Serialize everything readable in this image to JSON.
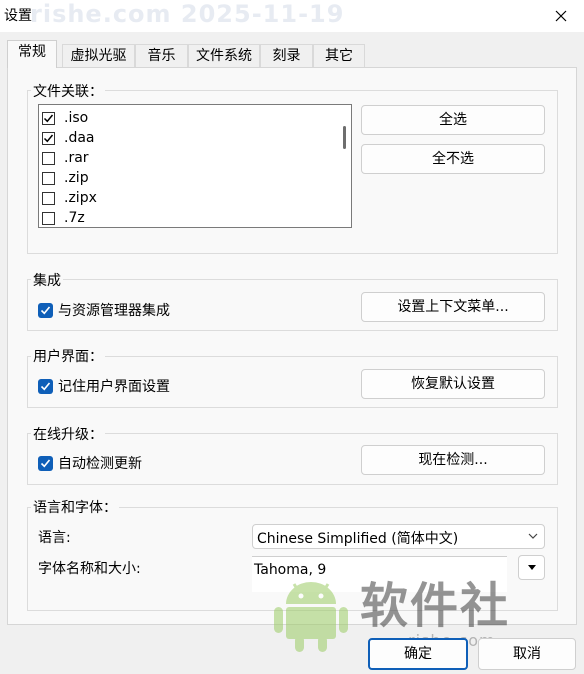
{
  "window": {
    "title": "设置",
    "watermark": "rishe.com 2025-11-19"
  },
  "tabs": [
    "常规",
    "虚拟光驱",
    "音乐",
    "文件系统",
    "刻录",
    "其它"
  ],
  "active_tab": "常规",
  "file_assoc": {
    "title": "文件关联：",
    "items": [
      {
        "label": ".iso",
        "checked": true
      },
      {
        "label": ".daa",
        "checked": true
      },
      {
        "label": ".rar",
        "checked": false
      },
      {
        "label": ".zip",
        "checked": false
      },
      {
        "label": ".zipx",
        "checked": false
      },
      {
        "label": ".7z",
        "checked": false
      }
    ],
    "select_all": "全选",
    "select_none": "全不选"
  },
  "integration": {
    "title": "集成",
    "checkbox_label": "与资源管理器集成",
    "checked": true,
    "button": "设置上下文菜单..."
  },
  "ui": {
    "title": "用户界面：",
    "checkbox_label": "记住用户界面设置",
    "checked": true,
    "button": "恢复默认设置"
  },
  "update": {
    "title": "在线升级：",
    "checkbox_label": "自动检测更新",
    "checked": true,
    "button": "现在检测..."
  },
  "lang": {
    "title": "语言和字体：",
    "lang_label": "语言:",
    "lang_value": "Chinese Simplified (简体中文)",
    "font_label": "字体名称和大小:",
    "font_value": "Tahoma, 9"
  },
  "watermark": {
    "big": "软件社",
    "small": "rishe.com"
  },
  "buttons": {
    "ok": "确定",
    "cancel": "取消"
  },
  "colors": {
    "accent": "#0f5fb8"
  }
}
